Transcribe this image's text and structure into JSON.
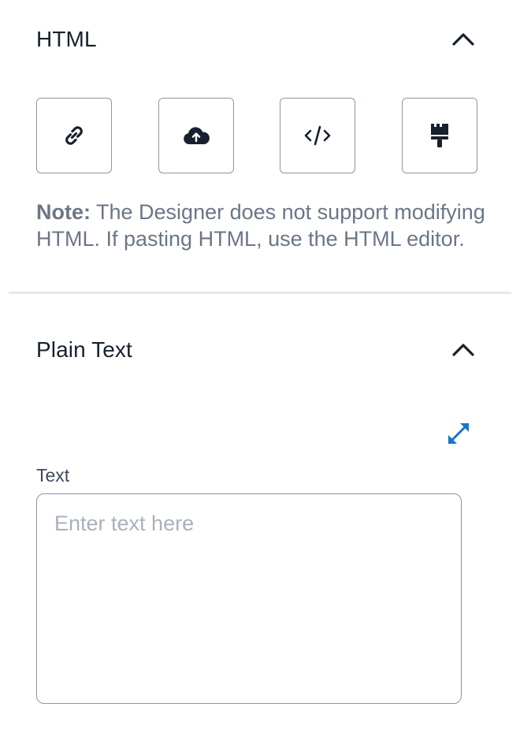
{
  "html_section": {
    "title": "HTML",
    "collapse_icon": "chevron-up-icon",
    "tools": [
      {
        "name": "link-button",
        "icon": "link-icon"
      },
      {
        "name": "upload-button",
        "icon": "cloud-upload-icon"
      },
      {
        "name": "code-editor-button",
        "icon": "code-icon"
      },
      {
        "name": "style-button",
        "icon": "paint-brush-icon"
      }
    ],
    "note_label": "Note:",
    "note_text": " The Designer does not support modifying HTML. If pasting HTML, use the HTML editor."
  },
  "plain_text_section": {
    "title": "Plain Text",
    "collapse_icon": "chevron-up-icon",
    "expand_icon": "expand-arrows-icon",
    "field_label": "Text",
    "placeholder": "Enter text here",
    "value": ""
  },
  "colors": {
    "text_primary": "#16202e",
    "text_muted": "#6b7686",
    "border": "#8a96a3",
    "accent": "#1a73c9",
    "divider": "#e6e8eb"
  }
}
